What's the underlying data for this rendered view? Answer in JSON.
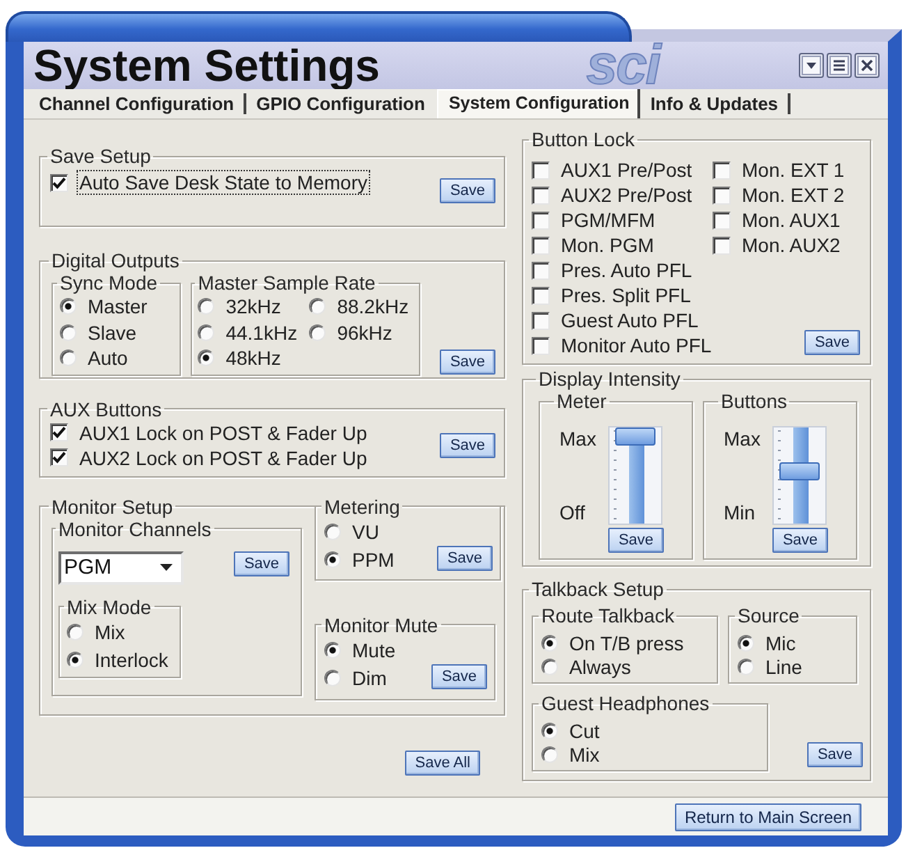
{
  "window": {
    "title": "System Settings",
    "logo": "sci"
  },
  "tabs": [
    {
      "label": "Channel Configuration",
      "selected": false
    },
    {
      "label": "GPIO Configuration",
      "selected": false
    },
    {
      "label": "System Configuration",
      "selected": true
    },
    {
      "label": "Info & Updates",
      "selected": false
    }
  ],
  "save_setup": {
    "title": "Save Setup",
    "checkboxes": [
      {
        "label": "Auto Save Desk State to Memory",
        "checked": true,
        "focused": true
      }
    ],
    "button": "Save"
  },
  "digital_outputs": {
    "title": "Digital Outputs",
    "sync_mode": {
      "title": "Sync Mode",
      "options": [
        {
          "label": "Master",
          "selected": true
        },
        {
          "label": "Slave",
          "selected": false
        },
        {
          "label": "Auto",
          "selected": false
        }
      ]
    },
    "master_sample_rate": {
      "title": "Master Sample Rate",
      "options": [
        {
          "label": "32kHz",
          "selected": false
        },
        {
          "label": "88.2kHz",
          "selected": false
        },
        {
          "label": "44.1kHz",
          "selected": false
        },
        {
          "label": "96kHz",
          "selected": false
        },
        {
          "label": "48kHz",
          "selected": true
        }
      ]
    },
    "button": "Save"
  },
  "aux_buttons": {
    "title": "AUX Buttons",
    "checkboxes": [
      {
        "label": "AUX1 Lock on POST & Fader Up",
        "checked": true
      },
      {
        "label": "AUX2 Lock on POST & Fader Up",
        "checked": true
      }
    ],
    "button": "Save"
  },
  "monitor_setup": {
    "title": "Monitor Setup",
    "monitor_channels": {
      "title": "Monitor Channels",
      "dropdown": {
        "value": "PGM"
      },
      "button": "Save",
      "mix_mode": {
        "title": "Mix Mode",
        "options": [
          {
            "label": "Mix",
            "selected": false
          },
          {
            "label": "Interlock",
            "selected": true
          }
        ]
      }
    },
    "metering": {
      "title": "Metering",
      "options": [
        {
          "label": "VU",
          "selected": false
        },
        {
          "label": "PPM",
          "selected": true
        }
      ],
      "button": "Save"
    },
    "monitor_mute": {
      "title": "Monitor Mute",
      "options": [
        {
          "label": "Mute",
          "selected": true
        },
        {
          "label": "Dim",
          "selected": false
        }
      ],
      "button": "Save"
    }
  },
  "save_all": {
    "label": "Save All"
  },
  "button_lock": {
    "title": "Button Lock",
    "columns": [
      {
        "checkboxes": [
          {
            "label": "AUX1 Pre/Post",
            "checked": false
          },
          {
            "label": "AUX2 Pre/Post",
            "checked": false
          },
          {
            "label": "PGM/MFM",
            "checked": false
          },
          {
            "label": "Mon. PGM",
            "checked": false
          },
          {
            "label": "Pres. Auto PFL",
            "checked": false
          },
          {
            "label": "Pres. Split PFL",
            "checked": false
          },
          {
            "label": "Guest Auto PFL",
            "checked": false
          },
          {
            "label": "Monitor Auto PFL",
            "checked": false
          }
        ]
      },
      {
        "checkboxes": [
          {
            "label": "Mon. EXT 1",
            "checked": false
          },
          {
            "label": "Mon. EXT 2",
            "checked": false
          },
          {
            "label": "Mon. AUX1",
            "checked": false
          },
          {
            "label": "Mon. AUX2",
            "checked": false
          }
        ]
      }
    ],
    "button": "Save"
  },
  "display_intensity": {
    "title": "Display Intensity",
    "sliders": [
      {
        "title": "Meter",
        "max_label": "Max",
        "min_label": "Off",
        "level": 1,
        "button": "Save"
      },
      {
        "title": "Buttons",
        "max_label": "Max",
        "min_label": "Min",
        "level": 0.55,
        "button": "Save"
      }
    ]
  },
  "talkback_setup": {
    "title": "Talkback Setup",
    "route_talkback": {
      "title": "Route Talkback",
      "options": [
        {
          "label": "On T/B press",
          "selected": true
        },
        {
          "label": "Always",
          "selected": false
        }
      ]
    },
    "source": {
      "title": "Source",
      "options": [
        {
          "label": "Mic",
          "selected": true
        },
        {
          "label": "Line",
          "selected": false
        }
      ]
    },
    "guest_headphones": {
      "title": "Guest Headphones",
      "options": [
        {
          "label": "Cut",
          "selected": true
        },
        {
          "label": "Mix",
          "selected": false
        }
      ]
    },
    "button": "Save"
  },
  "footer": {
    "button": "Return to Main Screen"
  }
}
